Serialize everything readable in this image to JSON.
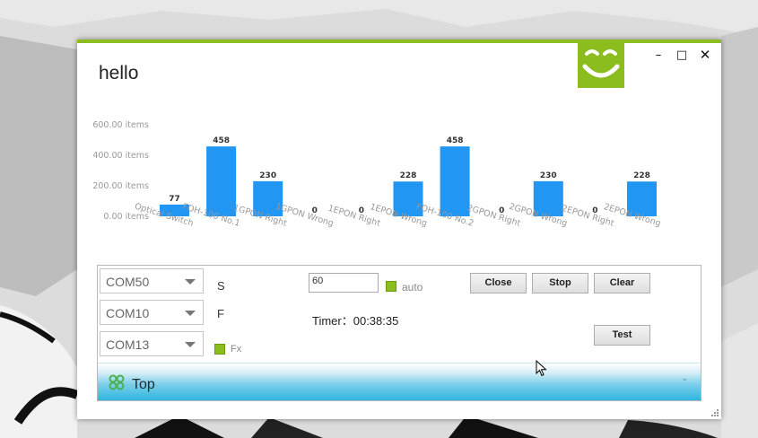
{
  "window": {
    "title": "hello",
    "controls": {
      "minimize": "–",
      "maximize": "□",
      "close": "✕"
    },
    "accent_color": "#8cbd1f"
  },
  "chart_data": {
    "type": "bar",
    "categories": [
      "Optical Switch",
      "FOH-100 No.1",
      "1GPON Right",
      "1GPON Wrong",
      "1EPON Right",
      "1EPON Wrong",
      "FOH-100 No.2",
      "2GPON Right",
      "2GPON Wrong",
      "2EPON Right",
      "2EPON Wrong"
    ],
    "values": [
      77,
      458,
      230,
      0,
      0,
      228,
      458,
      0,
      230,
      0,
      228
    ],
    "y_ticks": [
      "0.00 items",
      "200.00 items",
      "400.00 items",
      "600.00 items"
    ],
    "ylim": [
      0,
      600
    ],
    "bar_color": "#2196f3"
  },
  "panel": {
    "ports": [
      "COM50",
      "COM10",
      "COM13"
    ],
    "labels": {
      "s": "S",
      "f": "F"
    },
    "fx_label": "Fx",
    "interval_value": "60",
    "auto_label": "auto",
    "timer_text": "Timer：00:38:35",
    "buttons": {
      "close": "Close",
      "stop": "Stop",
      "clear": "Clear",
      "test": "Test"
    }
  },
  "footer": {
    "title": "Top",
    "expand_glyph": "⌄"
  }
}
